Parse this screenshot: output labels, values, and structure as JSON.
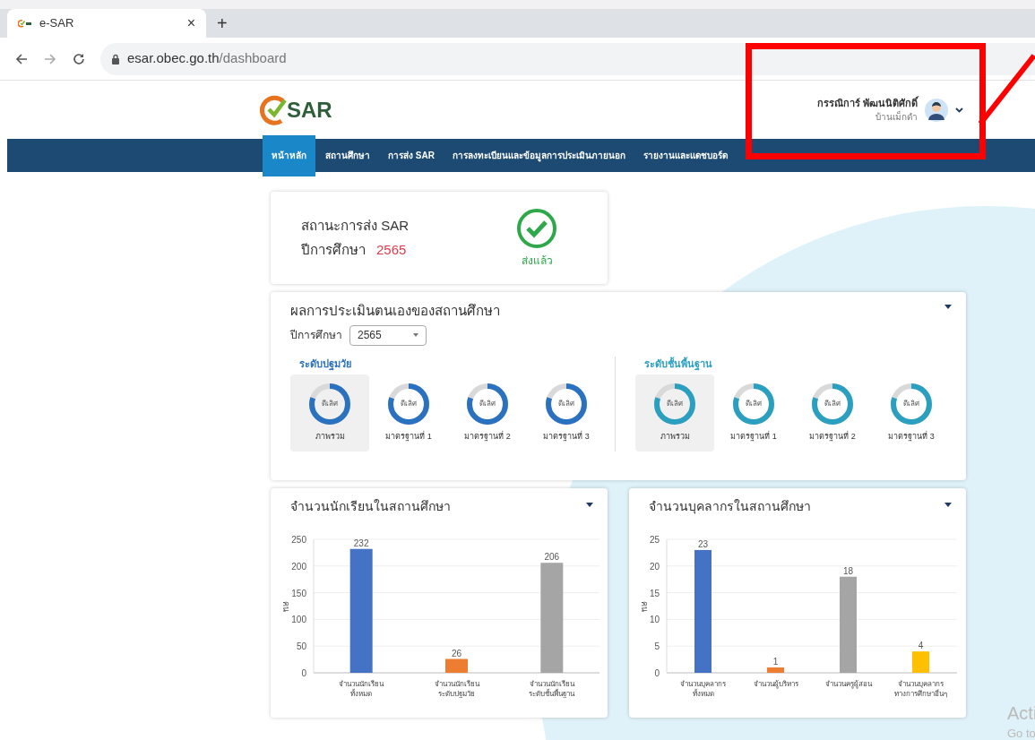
{
  "browser": {
    "tab_title": "e-SAR",
    "tab_close": "×",
    "new_tab": "+",
    "url_host": "esar.obec.go.th",
    "url_path": "/dashboard"
  },
  "header": {
    "logo_text": "SAR",
    "user_name": "กรรณิการ์ พัฒนนิติศักดิ์",
    "user_school": "บ้านเม็กดำ"
  },
  "nav": [
    {
      "label": "หน้าหลัก",
      "selected": true
    },
    {
      "label": "สถานศึกษา",
      "selected": false
    },
    {
      "label": "การส่ง SAR",
      "selected": false
    },
    {
      "label": "การลงทะเบียนและข้อมูลการประเมินภายนอก",
      "selected": false
    },
    {
      "label": "รายงานและแดชบอร์ด",
      "selected": false
    }
  ],
  "status_card": {
    "title": "สถานะการส่ง SAR",
    "year_label": "ปีการศึกษา",
    "year": "2565",
    "status": "ส่งแล้ว"
  },
  "assessment": {
    "title": "ผลการประเมินตนเองของสถานศึกษา",
    "year_label": "ปีการศึกษา",
    "year_value": "2565",
    "groups": [
      {
        "title": "ระดับปฐมวัย",
        "color": "#2a72bf",
        "items": [
          {
            "label": "ภาพรวม",
            "result": "ดีเลิศ",
            "level": 0.8,
            "selected": true
          },
          {
            "label": "มาตรฐานที่ 1",
            "result": "ดีเลิศ",
            "level": 0.8,
            "selected": false
          },
          {
            "label": "มาตรฐานที่ 2",
            "result": "ดีเลิศ",
            "level": 0.8,
            "selected": false
          },
          {
            "label": "มาตรฐานที่ 3",
            "result": "ดีเลิศ",
            "level": 0.8,
            "selected": false
          }
        ]
      },
      {
        "title": "ระดับชั้นพื้นฐาน",
        "color": "#2a9fc0",
        "items": [
          {
            "label": "ภาพรวม",
            "result": "ดีเลิศ",
            "level": 0.8,
            "selected": true
          },
          {
            "label": "มาตรฐานที่ 1",
            "result": "ดีเลิศ",
            "level": 0.8,
            "selected": false
          },
          {
            "label": "มาตรฐานที่ 2",
            "result": "ดีเลิศ",
            "level": 0.8,
            "selected": false
          },
          {
            "label": "มาตรฐานที่ 3",
            "result": "ดีเลิศ",
            "level": 0.8,
            "selected": false
          }
        ]
      }
    ]
  },
  "charts": [
    {
      "title": "จำนวนนักเรียนในสถานศึกษา",
      "chart_data": {
        "type": "bar",
        "ylabel": "คน",
        "categories": [
          "จำนวนนักเรียน\nทั้งหมด",
          "จำนวนนักเรียน\nระดับปฐมวัย",
          "จำนวนนักเรียน\nระดับชั้นพื้นฐาน"
        ],
        "series": [
          {
            "color": "#4472c4",
            "values": [
              232,
              null,
              null
            ]
          },
          {
            "color": "#ed7d31",
            "values": [
              null,
              26,
              null
            ]
          },
          {
            "color": "#a5a5a5",
            "values": [
              null,
              null,
              206
            ]
          }
        ],
        "ylim": [
          0,
          250
        ],
        "yticks": [
          0,
          50,
          100,
          150,
          200,
          250
        ],
        "grid": true,
        "data_labels": true
      }
    },
    {
      "title": "จำนวนบุคลากรในสถานศึกษา",
      "chart_data": {
        "type": "bar",
        "ylabel": "คน",
        "categories": [
          "จำนวนบุคลากร\nทั้งหมด",
          "จำนวนผู้บริหาร",
          "จำนวนครูผู้สอน",
          "จำนวนบุคลากร\nทางการศึกษาอื่นๆ"
        ],
        "series": [
          {
            "color": "#4472c4",
            "values": [
              23,
              null,
              null,
              null
            ]
          },
          {
            "color": "#ed7d31",
            "values": [
              null,
              1,
              null,
              null
            ]
          },
          {
            "color": "#a5a5a5",
            "values": [
              null,
              null,
              18,
              null
            ]
          },
          {
            "color": "#ffc000",
            "values": [
              null,
              null,
              null,
              4
            ]
          }
        ],
        "ylim": [
          0,
          25
        ],
        "yticks": [
          0,
          5,
          10,
          15,
          20,
          25
        ],
        "grid": true,
        "data_labels": true
      }
    }
  ],
  "system_notice": {
    "line_1": "Acti",
    "line_2": "Go to"
  }
}
